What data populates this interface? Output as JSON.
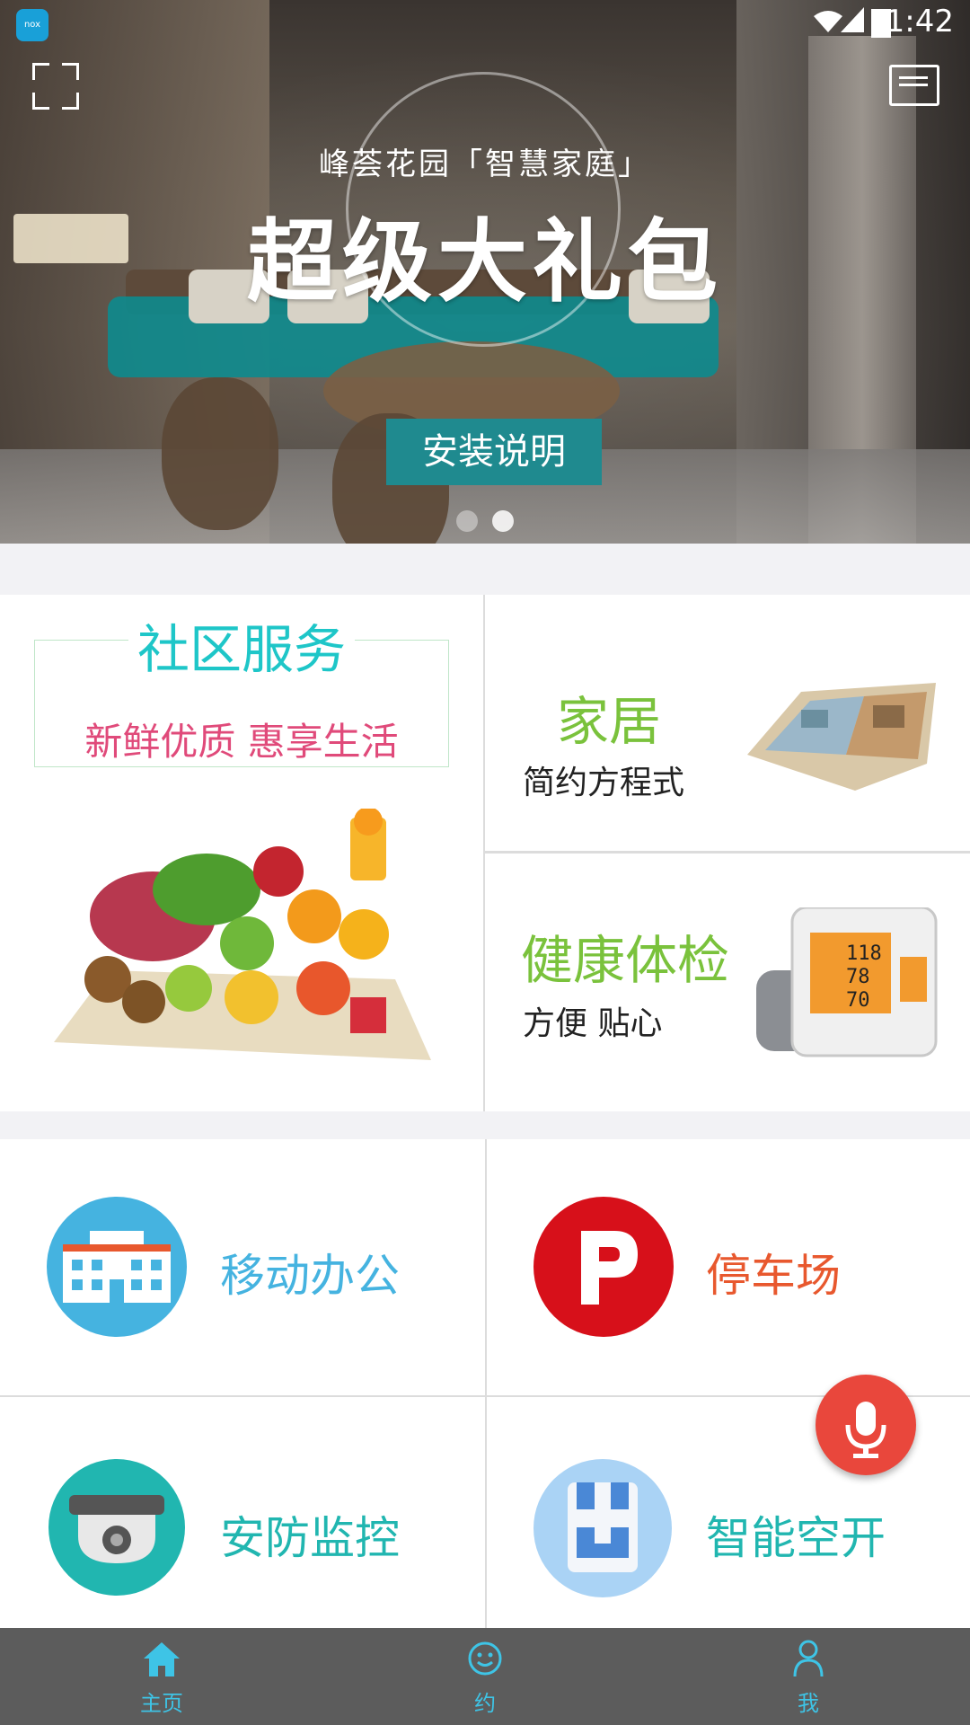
{
  "status": {
    "time": "1:42",
    "app_badge": "nox"
  },
  "banner": {
    "subtitle": "峰荟花园「智慧家庭」",
    "title": "超级大礼包",
    "button": "安装说明"
  },
  "community": {
    "title": "社区服务",
    "subtitle": "新鲜优质 惠享生活"
  },
  "home": {
    "title": "家居",
    "subtitle": "简约方程式"
  },
  "health": {
    "title": "健康体检",
    "subtitle": "方便 贴心"
  },
  "monitor_readings": {
    "top": "118",
    "mid": "78",
    "bot": "70"
  },
  "features": {
    "office": "移动办公",
    "parking": "停车场",
    "security": "安防监控",
    "switch": "智能空开"
  },
  "colors": {
    "accent": "#1ec6c8",
    "green": "#7ac23c",
    "pink": "#e04a7a",
    "orange": "#e8582e",
    "blue": "#45b3e0",
    "fab": "#e9473c",
    "tabbar": "#5c5c5c",
    "tab_active": "#3ec4e6"
  },
  "tabs": [
    {
      "label": "主页",
      "icon": "home-icon",
      "active": true
    },
    {
      "label": "约",
      "icon": "smile-icon",
      "active": false
    },
    {
      "label": "我",
      "icon": "person-icon",
      "active": false
    }
  ]
}
